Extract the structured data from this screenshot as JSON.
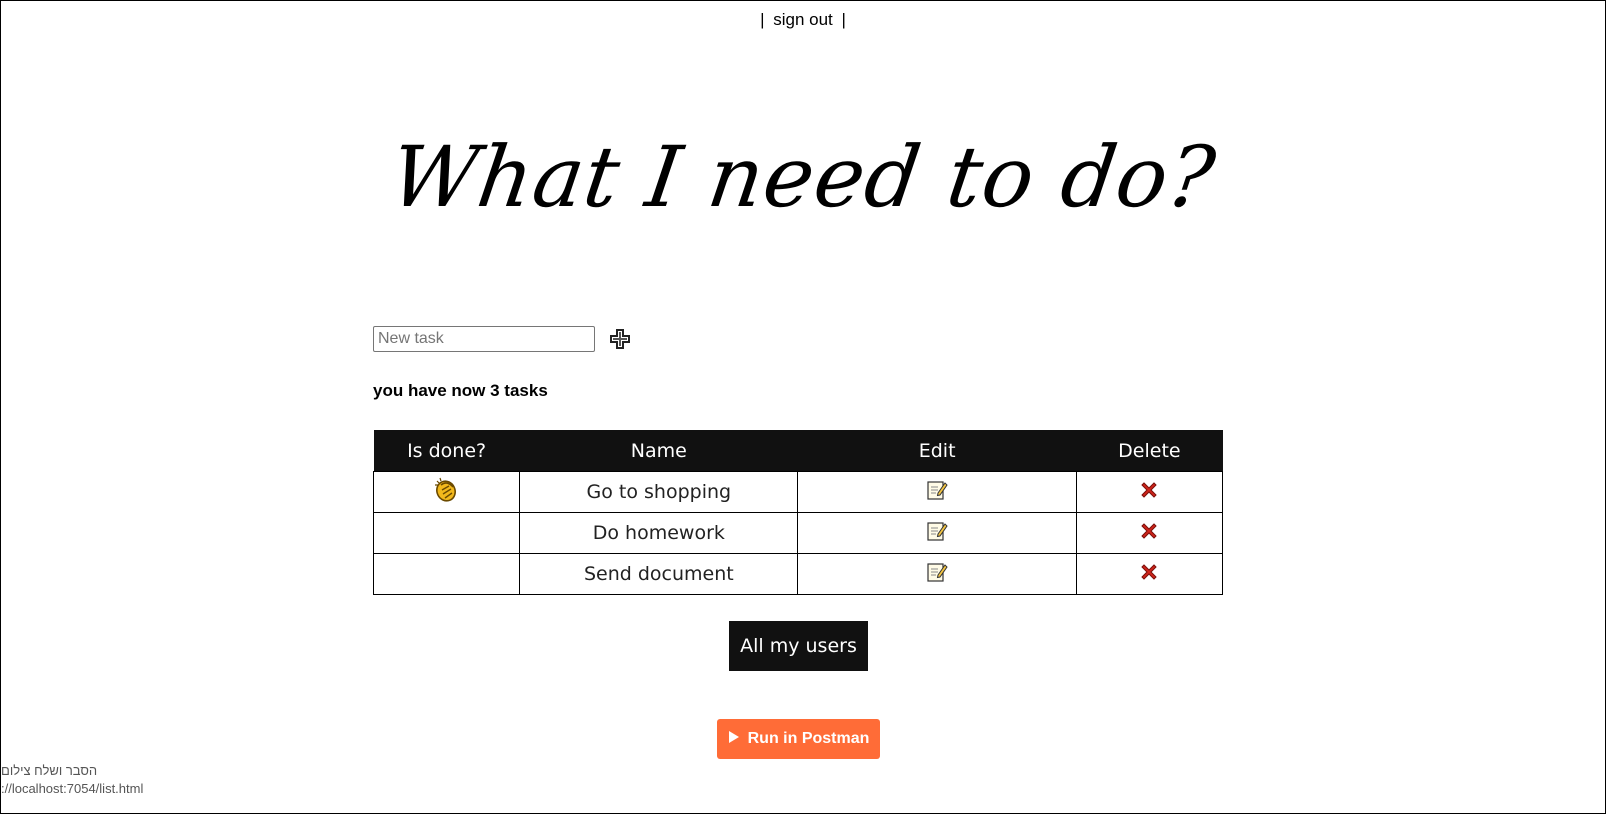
{
  "nav": {
    "left_pipe": "|",
    "sign_out": "sign out",
    "right_pipe": "|"
  },
  "title": "What I need to do?",
  "new_task": {
    "placeholder": "New task",
    "value": "",
    "add_icon": "plus-icon"
  },
  "task_count": "you have now 3 tasks",
  "table": {
    "headers": [
      "Is done?",
      "Name",
      "Edit",
      "Delete"
    ],
    "rows": [
      {
        "done": true,
        "done_icon": "clapping-hands-icon",
        "name": "Go to shopping",
        "edit_icon": "memo-icon",
        "delete_icon": "cross-mark-icon"
      },
      {
        "done": false,
        "done_icon": "",
        "name": "Do homework",
        "edit_icon": "memo-icon",
        "delete_icon": "cross-mark-icon"
      },
      {
        "done": false,
        "done_icon": "",
        "name": "Send document",
        "edit_icon": "memo-icon",
        "delete_icon": "cross-mark-icon"
      }
    ]
  },
  "users_button": "All my users",
  "postman_button": "Run in Postman",
  "status_bar": {
    "line1": "הסבר ושלח צילום",
    "url": "://localhost:7054/list.html"
  },
  "colors": {
    "header_bg": "#111111",
    "postman_orange": "#ff6c37",
    "delete_red": "#d0251b"
  }
}
